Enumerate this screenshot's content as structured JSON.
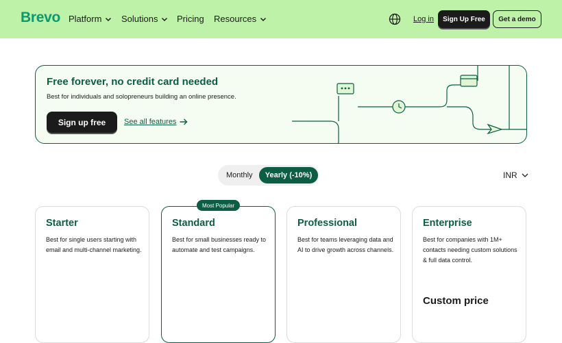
{
  "header": {
    "logo": "Brevo",
    "menu": [
      {
        "label": "Platform",
        "has_dropdown": true
      },
      {
        "label": "Solutions",
        "has_dropdown": true
      },
      {
        "label": "Pricing",
        "has_dropdown": false
      },
      {
        "label": "Resources",
        "has_dropdown": true
      }
    ],
    "globe_icon": "globe-icon",
    "login_label": "Log in",
    "signup_label": "Sign Up Free",
    "demo_label": "Get a demo",
    "bg_color": "#bff2a9"
  },
  "promo": {
    "title": "Free forever, no credit card needed",
    "subtitle": "Best for individuals and solopreneurs building an online presence.",
    "button_label": "Sign up free",
    "link_label": "See all features",
    "accent_color": "#0b5d44"
  },
  "billing": {
    "monthly_label": "Monthly",
    "yearly_label": "Yearly (-10%)",
    "selected": "Yearly (-10%)",
    "currency": "INR"
  },
  "plans": [
    {
      "name": "Starter",
      "description": "Best for single users starting with email and multi-channel marketing.",
      "price": "",
      "badge": ""
    },
    {
      "name": "Standard",
      "description": "Best for small businesses ready to automate and test campaigns.",
      "price": "",
      "badge": "Most Popular"
    },
    {
      "name": "Professional",
      "description": "Best for teams leveraging data and AI to drive growth across channels.",
      "price": "",
      "badge": ""
    },
    {
      "name": "Enterprise",
      "description": "Best for companies with 1M+ contacts needing custom solutions & full data control.",
      "price": "Custom price",
      "badge": ""
    }
  ]
}
